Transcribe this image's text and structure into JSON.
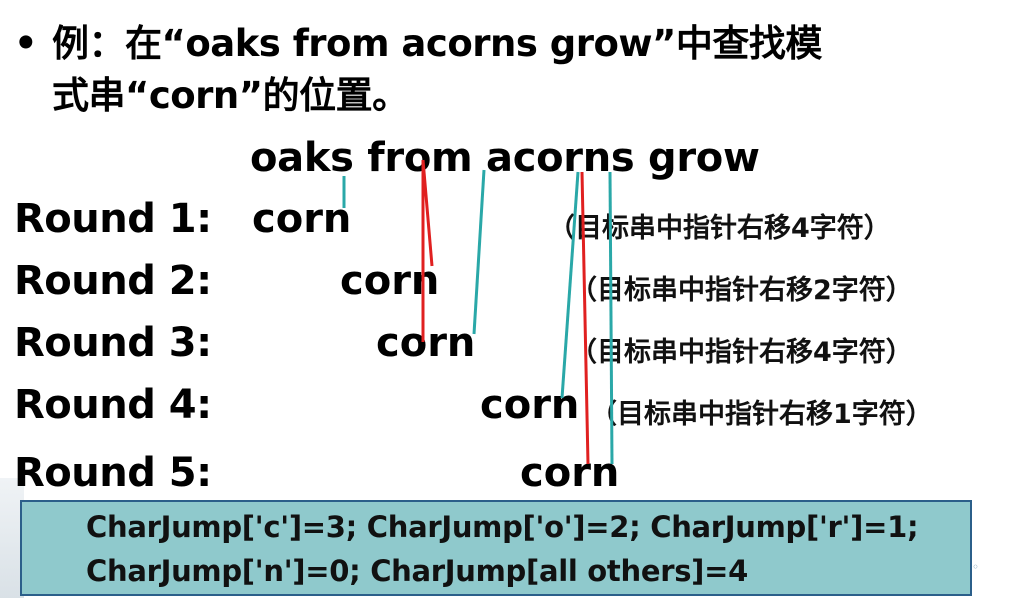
{
  "bullet": {
    "dot": "•",
    "line1": "例：在“oaks from acorns grow”中查找模",
    "line2": "式串“corn”的位置。"
  },
  "target": "oaks from acorns grow",
  "rounds": [
    {
      "label": "Round 1:",
      "pattern": "corn",
      "note": "（目标串中指针右移4字符）"
    },
    {
      "label": "Round 2:",
      "pattern": "corn",
      "note": "（目标串中指针右移2字符）"
    },
    {
      "label": "Round 3:",
      "pattern": "corn",
      "note": "（目标串中指针右移4字符）"
    },
    {
      "label": "Round 4:",
      "pattern": "corn",
      "note": "（目标串中指针右移1字符）"
    },
    {
      "label": "Round 5:",
      "pattern": "corn",
      "note": ""
    }
  ],
  "charjump": {
    "line1": "CharJump['c']=3; CharJump['o']=2; CharJump['r']=1;",
    "line2": "CharJump['n']=0; CharJump[all others]=4"
  },
  "colors": {
    "teal_line": "#2aa8a8",
    "red_line": "#e02020",
    "box_fill": "#8fc9cc",
    "box_border": "#2b5f8a"
  }
}
